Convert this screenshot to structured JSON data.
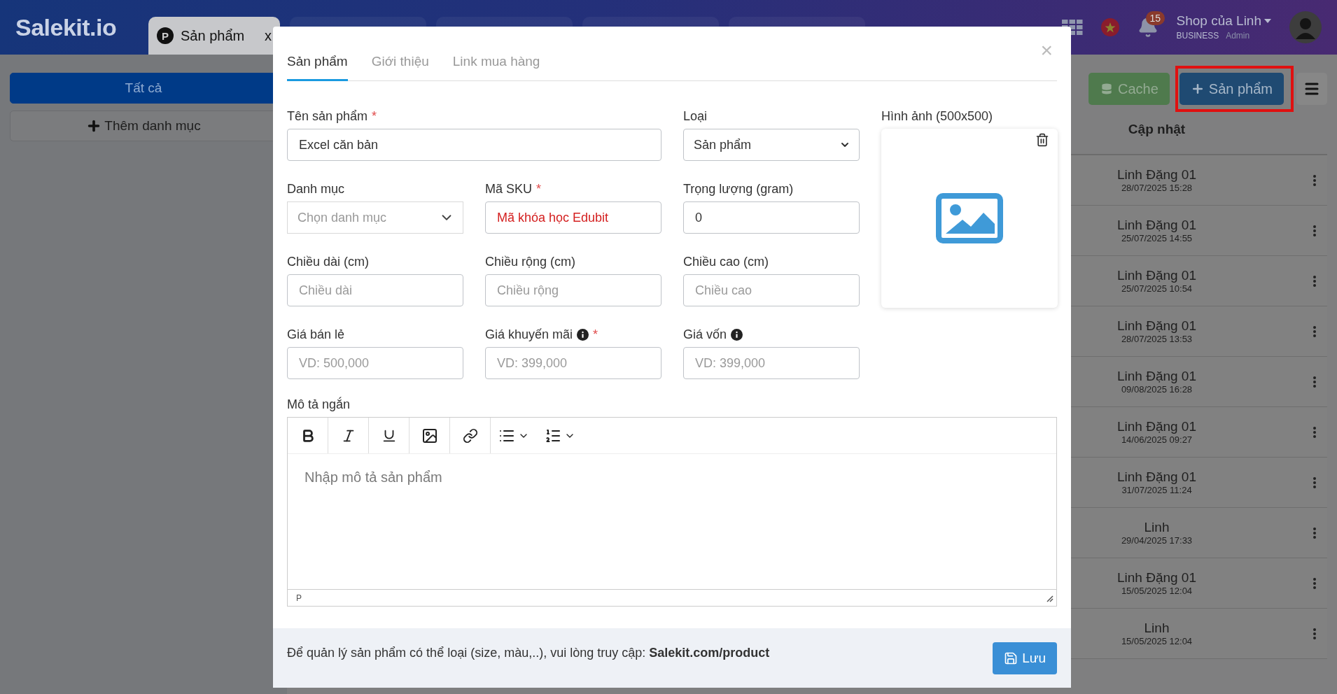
{
  "header": {
    "logo": "Salekit.io",
    "tabs": [
      {
        "badge": "P",
        "label": "Sản phẩm",
        "close": "x",
        "selected": true
      },
      {
        "selected": false
      },
      {
        "selected": false
      },
      {
        "selected": false
      },
      {
        "selected": false
      }
    ],
    "notification_count": "15",
    "user": {
      "name": "Shop của Linh",
      "plan": "BUSINESS",
      "role": "Admin"
    }
  },
  "sidebar": {
    "categories": [
      {
        "label": "Tất cả",
        "selected": true
      }
    ],
    "add_button": "Thêm danh mục"
  },
  "toolbar": {
    "cache_button": "Cache",
    "add_button": "Sản phẩm",
    "add_button_highlighted": true
  },
  "table": {
    "columns": [
      "Cập nhật"
    ],
    "rows": [
      {
        "user": "Linh Đặng 01",
        "time": "28/07/2025 15:28"
      },
      {
        "user": "Linh Đặng 01",
        "time": "25/07/2025 14:55"
      },
      {
        "user": "Linh Đặng 01",
        "time": "25/07/2025 10:54"
      },
      {
        "user": "Linh Đặng 01",
        "time": "28/07/2025 13:53"
      },
      {
        "user": "Linh Đặng 01",
        "time": "09/08/2025 16:28"
      },
      {
        "user": "Linh Đặng 01",
        "time": "14/06/2025 09:27"
      },
      {
        "user": "Linh Đặng 01",
        "time": "31/07/2025 11:24"
      },
      {
        "user": "Linh",
        "time": "29/04/2025 17:33"
      },
      {
        "user": "Linh Đặng 01",
        "time": "15/05/2025 12:04"
      },
      {
        "user": "Linh",
        "time": "15/05/2025 12:04"
      }
    ]
  },
  "modal": {
    "close": "×",
    "tabs": [
      {
        "label": "Sản phẩm",
        "selected": true
      },
      {
        "label": "Giới thiệu",
        "selected": false
      },
      {
        "label": "Link mua hàng",
        "selected": false
      }
    ],
    "fields": [
      {
        "kind": "text",
        "label": "Tên sản phẩm",
        "required_mark": "*",
        "info": false,
        "wide": true,
        "invalid": false,
        "value": "Excel căn bản"
      },
      {
        "kind": "select",
        "label": "Loại",
        "info": false,
        "wide": false,
        "invalid": false,
        "value": "Sản phẩm"
      },
      {
        "kind": "dropdown",
        "label": "Danh mục",
        "info": false,
        "wide": false,
        "invalid": false,
        "placeholder": "Chọn danh mục"
      },
      {
        "kind": "text",
        "label": "Mã SKU",
        "required_mark": "*",
        "info": false,
        "wide": false,
        "invalid": true,
        "value": "Mã khóa học Edubit"
      },
      {
        "kind": "text",
        "label": "Trọng lượng (gram)",
        "info": false,
        "wide": false,
        "invalid": false,
        "value": "0"
      },
      {
        "kind": "text",
        "label": "Chiều dài (cm)",
        "info": false,
        "wide": false,
        "invalid": false,
        "placeholder": "Chiều dài"
      },
      {
        "kind": "text",
        "label": "Chiều rộng (cm)",
        "info": false,
        "wide": false,
        "invalid": false,
        "placeholder": "Chiều rộng"
      },
      {
        "kind": "text",
        "label": "Chiều cao (cm)",
        "info": false,
        "wide": false,
        "invalid": false,
        "placeholder": "Chiều cao"
      },
      {
        "kind": "text",
        "label": "Giá bán lẻ",
        "info": false,
        "wide": false,
        "invalid": false,
        "placeholder": "VD: 500,000"
      },
      {
        "kind": "text",
        "label": "Giá khuyến mãi",
        "required_mark": "*",
        "info": true,
        "wide": false,
        "invalid": false,
        "placeholder": "VD: 399,000"
      },
      {
        "kind": "text",
        "label": "Giá vốn",
        "info": true,
        "wide": false,
        "invalid": false,
        "placeholder": "VD: 399,000"
      }
    ],
    "image": {
      "label": "Hình ảnh (500x500)"
    },
    "description": {
      "label": "Mô tả ngắn",
      "placeholder": "Nhập mô tả sản phẩm",
      "path": "P"
    },
    "footer": {
      "note": "Để quản lý sản phẩm có thể loại (size, màu,..), vui lòng truy cập: **Salekit.com/product**",
      "save_button": "Lưu"
    }
  }
}
